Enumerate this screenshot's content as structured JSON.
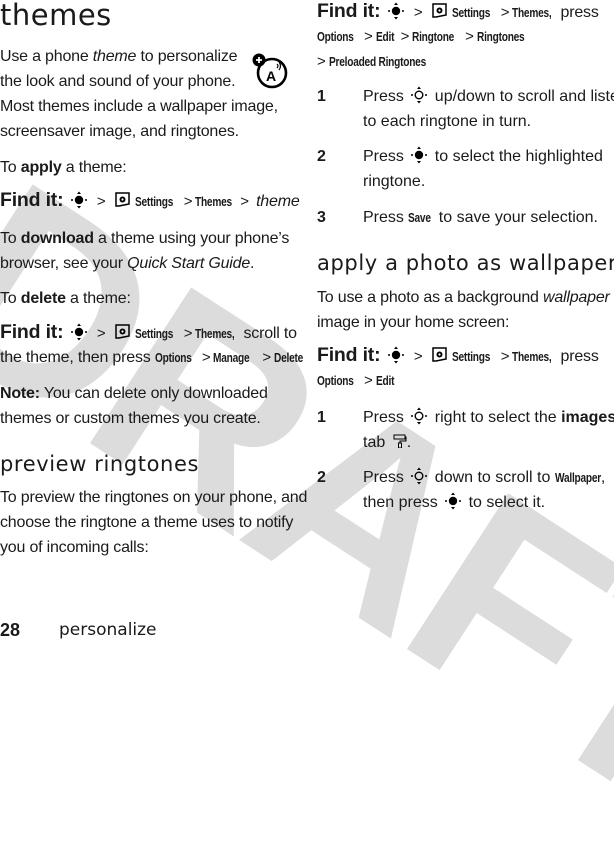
{
  "watermark": "DRAFT",
  "left": {
    "title": "themes",
    "intro": [
      "Use a phone ",
      "theme",
      " to personalize",
      "the look and sound of your phone.",
      "Most themes include a wallpaper image,",
      "screensaver image, and ringtones."
    ],
    "apply": {
      "pre": "To ",
      "bold": "apply",
      "post": " a theme:"
    },
    "find1": {
      "label": "Find it:",
      "settings": "Settings",
      "themes": "Themes",
      "tail": "theme"
    },
    "download": {
      "pre": "To ",
      "bold": "download",
      "post": " a theme using your phone’s",
      "line2_pre": "browser, see your ",
      "line2_italic": "Quick Start Guide",
      "line2_post": "."
    },
    "delete": {
      "pre": "To ",
      "bold": "delete",
      "post": " a theme:"
    },
    "find2": {
      "label": "Find it:",
      "settings": "Settings",
      "themes": "Themes,",
      "tail": " scroll to",
      "line2_pre": "the theme, then press ",
      "options": "Options",
      "manage": "Manage",
      "delete": "Delete"
    },
    "note": {
      "bold": "Note:",
      "text": " You can delete only downloaded",
      "line2": "themes or custom themes you create."
    },
    "preview_heading": "preview ringtones",
    "preview_text": [
      "To preview the ringtones on your phone, and",
      "choose the ringtone a theme uses to notify",
      "you of incoming calls:"
    ]
  },
  "right": {
    "find3": {
      "label": "Find it:",
      "settings": "Settings",
      "themes": "Themes,",
      "tail": " press",
      "options": "Options",
      "edit": "Edit",
      "ringtone": "Ringtone",
      "ringtones": "Ringtones",
      "preloaded": "Preloaded Ringtones"
    },
    "steps1": [
      {
        "num": "1",
        "pre": "Press ",
        "post": " up/down to scroll and listen",
        "line2": "to each ringtone in turn."
      },
      {
        "num": "2",
        "pre": "Press ",
        "post": " to select the highlighted",
        "line2": "ringtone."
      },
      {
        "num": "3",
        "pre": "Press ",
        "cmd": "Save",
        "post": " to save your selection."
      }
    ],
    "wallpaper_heading": "apply a photo as wallpaper",
    "wallpaper_text": {
      "pre": "To use a photo as a background ",
      "italic": "wallpaper",
      "line2": "image in your home screen:"
    },
    "find4": {
      "label": "Find it:",
      "settings": "Settings",
      "themes": "Themes,",
      "tail": " press",
      "options": "Options",
      "edit": "Edit"
    },
    "steps2": [
      {
        "num": "1",
        "pre": "Press ",
        "post": " right to select the ",
        "bold": "images",
        "line2_pre": "tab ",
        "line2_post": "."
      },
      {
        "num": "2",
        "pre": "Press ",
        "post": " down to scroll to ",
        "cmd": "Wallpaper",
        "cmd_post": ",",
        "line2_pre": "then press ",
        "line2_post": " to select it."
      }
    ]
  },
  "footer": {
    "page": "28",
    "section": "personalize"
  }
}
